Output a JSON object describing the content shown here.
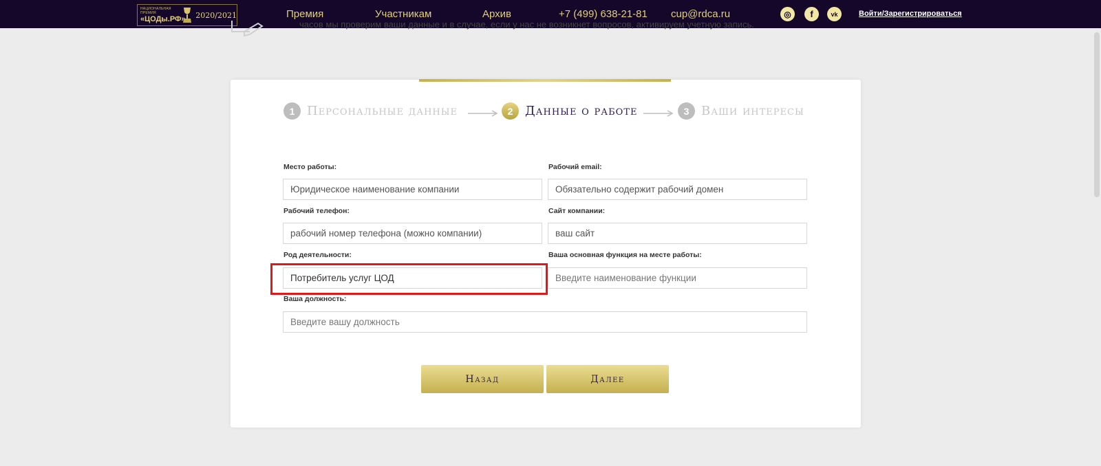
{
  "header": {
    "logo": {
      "small_text": "НАЦИОНАЛЬНАЯ ПРЕМИЯ",
      "main_text": "«ЦОДы.РФ»",
      "years": "2020/2021"
    },
    "nav": [
      "Премия",
      "Участникам",
      "Архив"
    ],
    "phone": "+7 (499) 638-21-81",
    "email": "cup@rdca.ru",
    "social": {
      "instagram": "◎",
      "facebook": "f",
      "vk": "vk"
    },
    "login": "Войти/Зарегистрироваться"
  },
  "background": {
    "partial_text": "часов мы проверим ваши данные и в случае, если у нас не возникнет вопросов, активируем учетную запись."
  },
  "steps": [
    {
      "num": "1",
      "label": "Персональные данные"
    },
    {
      "num": "2",
      "label": "Данные о работе"
    },
    {
      "num": "3",
      "label": "Ваши интересы"
    }
  ],
  "form": {
    "workplace": {
      "label": "Место работы:",
      "placeholder": "Юридическое наименование компании"
    },
    "work_email": {
      "label": "Рабочий email:",
      "placeholder": "Обязательно содержит рабочий домен"
    },
    "work_phone": {
      "label": "Рабочий телефон:",
      "placeholder": "рабочий номер телефона (можно компании)"
    },
    "company_site": {
      "label": "Сайт компании:",
      "placeholder": "ваш сайт"
    },
    "activity": {
      "label": "Род деятельности:",
      "value": "Потребитель услуг ЦОД"
    },
    "function": {
      "label": "Ваша основная функция на месте работы:",
      "placeholder": "Введите наименование функции"
    },
    "position": {
      "label": "Ваша должность:",
      "placeholder": "Введите вашу должность"
    }
  },
  "buttons": {
    "back": "Назад",
    "next": "Далее"
  },
  "colors": {
    "header_bg": "#14072a",
    "gold": "#c7b24c",
    "highlight": "#e0181b"
  }
}
